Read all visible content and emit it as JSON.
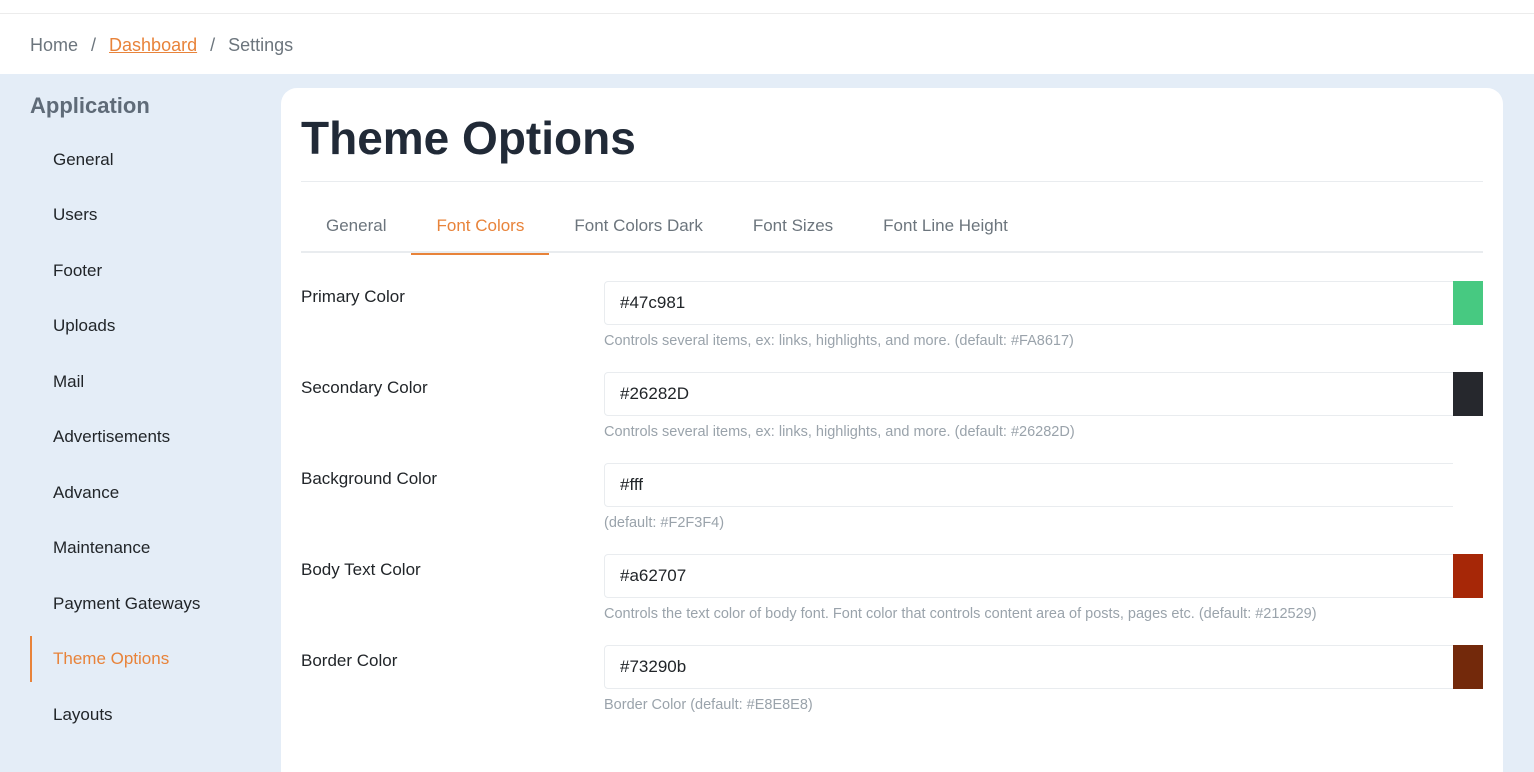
{
  "breadcrumb": {
    "home": "Home",
    "sep1": "/",
    "dashboard": "Dashboard",
    "sep2": "/",
    "settings": "Settings"
  },
  "sidebar": {
    "title": "Application",
    "items": [
      {
        "label": "General"
      },
      {
        "label": "Users"
      },
      {
        "label": "Footer"
      },
      {
        "label": "Uploads"
      },
      {
        "label": "Mail"
      },
      {
        "label": "Advertisements"
      },
      {
        "label": "Advance"
      },
      {
        "label": "Maintenance"
      },
      {
        "label": "Payment Gateways"
      },
      {
        "label": "Theme Options",
        "active": true
      },
      {
        "label": "Layouts"
      }
    ]
  },
  "page": {
    "title": "Theme Options"
  },
  "tabs": [
    {
      "label": "General"
    },
    {
      "label": "Font Colors",
      "active": true
    },
    {
      "label": "Font Colors Dark"
    },
    {
      "label": "Font Sizes"
    },
    {
      "label": "Font Line Height"
    }
  ],
  "fields": [
    {
      "label": "Primary Color",
      "value": "#47c981",
      "help": "Controls several items, ex: links, highlights, and more. (default: #FA8617)",
      "swatch": "#47c981"
    },
    {
      "label": "Secondary Color",
      "value": "#26282D",
      "help": "Controls several items, ex: links, highlights, and more. (default: #26282D)",
      "swatch": "#26282D"
    },
    {
      "label": "Background Color",
      "value": "#fff",
      "help": "(default: #F2F3F4)",
      "swatch": "#ffffff"
    },
    {
      "label": "Body Text Color",
      "value": "#a62707",
      "help": "Controls the text color of body font. Font color that controls content area of posts, pages etc. (default: #212529)",
      "swatch": "#a62707"
    },
    {
      "label": "Border Color",
      "value": "#73290b",
      "help": "Border Color (default: #E8E8E8)",
      "swatch": "#73290b"
    }
  ],
  "colors": {
    "accent": "#e8833a",
    "page_bg": "#e4edf7"
  }
}
